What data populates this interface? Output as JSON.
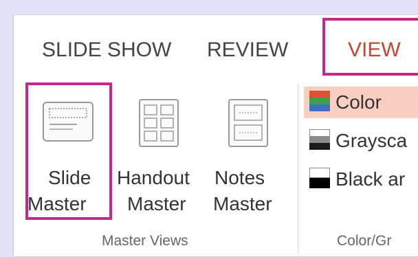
{
  "tabs": [
    {
      "label": "SLIDE SHOW",
      "active": false
    },
    {
      "label": "REVIEW",
      "active": false
    },
    {
      "label": "VIEW",
      "active": true
    }
  ],
  "master_views": {
    "buttons": [
      {
        "line1": "Slide",
        "line2": "Master",
        "icon": "slide-master-icon"
      },
      {
        "line1": "Handout",
        "line2": "Master",
        "icon": "handout-master-icon"
      },
      {
        "line1": "Notes",
        "line2": "Master",
        "icon": "notes-master-icon"
      }
    ],
    "group_label": "Master Views"
  },
  "color_grayscale": {
    "options": [
      {
        "label": "Color",
        "icon": "color-swatch-icon",
        "selected": true
      },
      {
        "label": "Graysca",
        "icon": "grayscale-swatch-icon",
        "selected": false
      },
      {
        "label": "Black ar",
        "icon": "black-white-swatch-icon",
        "selected": false
      }
    ],
    "group_label": "Color/Gr"
  },
  "colors": {
    "highlight": "#c4288e",
    "active_tab": "#c4472f",
    "selected_option_bg": "#f8cfc0"
  }
}
